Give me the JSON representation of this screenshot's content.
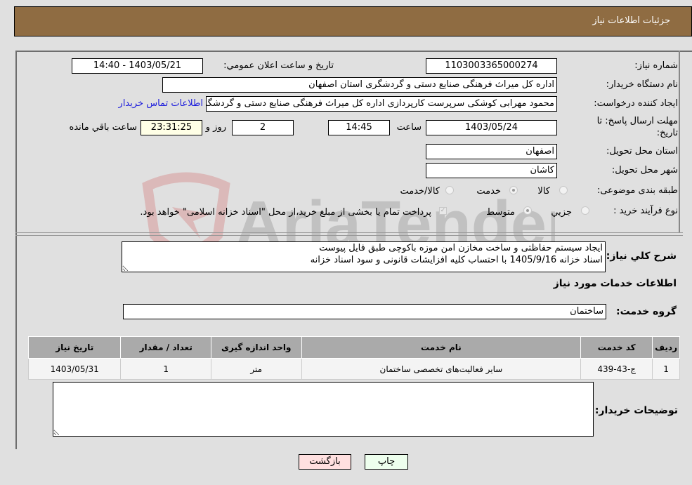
{
  "header": {
    "title": "جزئیات اطلاعات نیاز"
  },
  "fields": {
    "need_number": {
      "label": "شماره نیاز:",
      "value": "1103003365000274"
    },
    "announce_datetime": {
      "label": "تاریخ و ساعت اعلان عمومي:",
      "value": "1403/05/21 - 14:40"
    },
    "buyer_org": {
      "label": "نام دستگاه خریدار:",
      "value": "اداره کل میراث فرهنگی  صنایع دستی و گردشگری استان اصفهان"
    },
    "requester": {
      "label": "ایجاد کننده درخواست:",
      "value": "محمود مهرابی کوشکی سرپرست کارپردازی اداره کل میراث فرهنگی  صنایع دستی و گردشگری استان اصفهان"
    },
    "buyer_contact_link": "اطلاعات تماس خریدار",
    "deadline": {
      "label_line1": "مهلت ارسال پاسخ: تا",
      "label_line2": "تاریخ:",
      "date": "1403/05/24",
      "time_label": "ساعت",
      "time": "14:45",
      "days": "2",
      "days_label": "روز و",
      "remaining": "23:31:25",
      "remaining_label": "ساعت باقي مانده"
    },
    "province": {
      "label": "استان محل تحویل:",
      "value": "اصفهان"
    },
    "city": {
      "label": "شهر محل تحویل:",
      "value": "کاشان"
    },
    "category": {
      "label": "طبقه بندی موضوعی:",
      "options": [
        "کالا",
        "خدمت",
        "کالا/خدمت"
      ],
      "selected": "خدمت"
    },
    "purchase_process": {
      "label": "نوع فرآیند خرید :",
      "options": [
        "جزيي",
        "متوسط"
      ],
      "selected": "متوسط",
      "payment_note": "پرداخت تمام یا بخشی از مبلغ خرید،از محل \"اسناد خزانه اسلامی\" خواهد بود.",
      "payment_checked": true
    }
  },
  "description": {
    "label": "شرح کلي نیاز:",
    "value": "ایجاد سیستم حفاظتی و ساخت مخازن امن موزه باکوچی طبق فایل پیوست\nاسناد خزانه 1405/9/16 با احتساب کلیه افزایشات قانونی و سود اسناد خزانه"
  },
  "services_section": {
    "title": "اطلاعات خدمات مورد نیاز",
    "group_label": "گروه خدمت:",
    "group_value": "ساختمان",
    "table": {
      "headers": [
        "ردیف",
        "کد خدمت",
        "نام خدمت",
        "واحد اندازه گیری",
        "تعداد / مقدار",
        "تاریخ نیاز"
      ],
      "rows": [
        [
          "1",
          "ج-43-439",
          "سایر فعالیت‌های تخصصی ساختمان",
          "متر",
          "1",
          "1403/05/31"
        ]
      ]
    }
  },
  "buyer_notes": {
    "label": "توضیحات خریدار:",
    "value": ""
  },
  "buttons": {
    "print": "چاپ",
    "back": "بازگشت"
  },
  "watermark": {
    "text": "AriaTender.neT",
    "brand_color": "#d9a0a0"
  }
}
